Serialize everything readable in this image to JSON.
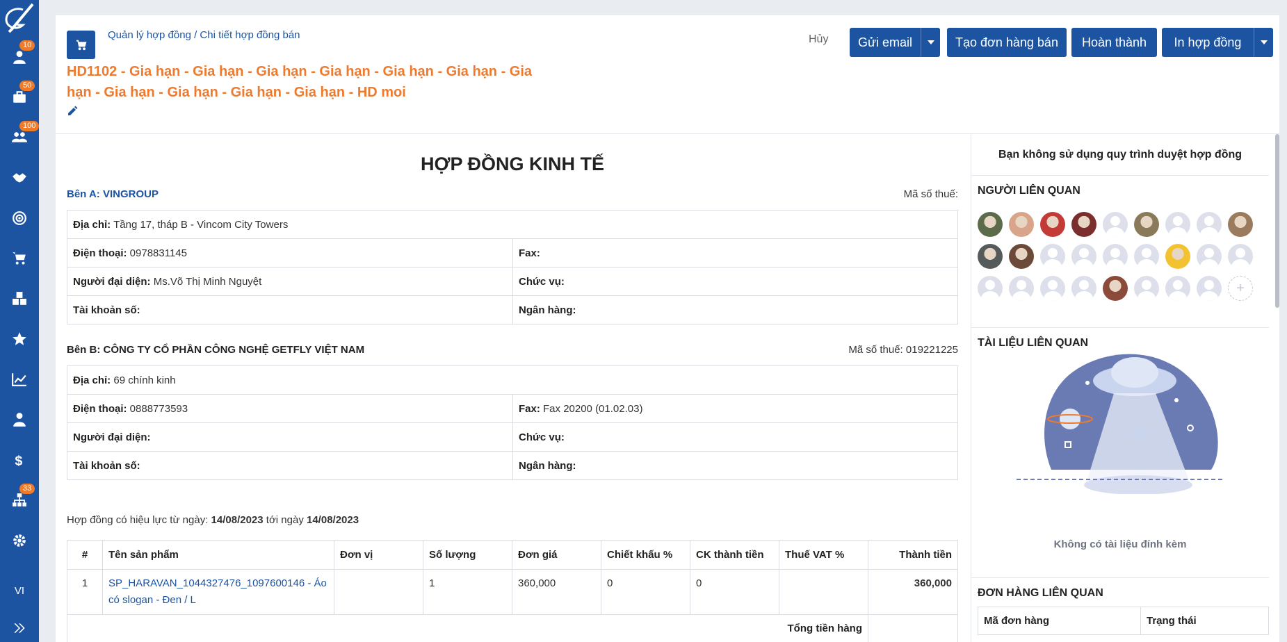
{
  "sidebar": {
    "items": [
      {
        "icon": "user-icon",
        "badge": "10"
      },
      {
        "icon": "briefcase-icon",
        "badge": "50"
      },
      {
        "icon": "users-icon",
        "badge": "100"
      },
      {
        "icon": "handshake-icon",
        "badge": ""
      },
      {
        "icon": "target-icon",
        "badge": ""
      },
      {
        "icon": "cart-icon",
        "badge": ""
      },
      {
        "icon": "cubes-icon",
        "badge": ""
      },
      {
        "icon": "star-icon",
        "badge": ""
      },
      {
        "icon": "chart-line-icon",
        "badge": ""
      },
      {
        "icon": "user-tie-icon",
        "badge": ""
      },
      {
        "icon": "dollar-icon",
        "badge": ""
      },
      {
        "icon": "sitemap-icon",
        "badge": "33"
      },
      {
        "icon": "gear-icon",
        "badge": ""
      }
    ],
    "lang": "VI"
  },
  "header": {
    "breadcrumb": "Quản lý hợp đồng / Chi tiết hợp đồng bán",
    "title": "HD1102 - Gia hạn - Gia hạn - Gia hạn - Gia hạn - Gia hạn - Gia hạn - Gia hạn - Gia hạn - Gia hạn - Gia hạn - Gia hạn - HD moi",
    "cancel_label": "Hủy",
    "send_email_label": "Gửi email",
    "create_order_label": "Tạo đơn hàng bán",
    "complete_label": "Hoàn thành",
    "print_label": "In hợp đồng"
  },
  "contract": {
    "doc_title": "HỢP ĐỒNG KINH TẾ",
    "party_a": {
      "heading": "Bên A: VINGROUP",
      "tax_label": "Mã số thuế:",
      "address_label": "Địa chỉ:",
      "address": "Tầng 17, tháp B - Vincom City Towers",
      "phone_label": "Điện thoại:",
      "phone": "0978831145",
      "fax_label": "Fax:",
      "fax": "",
      "rep_label": "Người đại diện:",
      "rep": "Ms.Võ Thị Minh Nguyệt",
      "position_label": "Chức vụ:",
      "position": "",
      "account_label": "Tài khoản số:",
      "account": "",
      "bank_label": "Ngân hàng:",
      "bank": ""
    },
    "party_b": {
      "heading": "Bên B: CÔNG TY CỔ PHẦN CÔNG NGHỆ GETFLY VIỆT NAM",
      "tax_label": "Mã số thuế:",
      "tax": "019221225",
      "address_label": "Địa chỉ:",
      "address": "69 chính kinh",
      "phone_label": "Điện thoại:",
      "phone": "0888773593",
      "fax_label": "Fax:",
      "fax": "Fax 20200 (01.02.03)",
      "rep_label": "Người đại diện:",
      "rep": "",
      "position_label": "Chức vụ:",
      "position": "",
      "account_label": "Tài khoản số:",
      "account": "",
      "bank_label": "Ngân hàng:",
      "bank": ""
    },
    "effective": {
      "prefix": "Hợp đồng có hiệu lực từ ngày:",
      "from": "14/08/2023",
      "middle": "tới ngày",
      "to": "14/08/2023"
    },
    "products": {
      "headers": [
        "#",
        "Tên sản phẩm",
        "Đơn vị",
        "Số lượng",
        "Đơn giá",
        "Chiết khấu %",
        "CK thành tiền",
        "Thuế VAT %",
        "Thành tiền"
      ],
      "rows": [
        {
          "no": "1",
          "name": "SP_HARAVAN_1044327476_1097600146 - Áo có slogan - Đen / L",
          "unit": "",
          "qty": "1",
          "price": "360,000",
          "discount_pct": "0",
          "discount_amount": "0",
          "vat": "",
          "total": "360,000"
        }
      ],
      "total_label": "Tổng tiền hàng"
    }
  },
  "right_panel": {
    "no_approval": "Bạn không sử dụng quy trình duyệt hợp đồng",
    "related_people_title": "NGƯỜI LIÊN QUAN",
    "related_docs_title": "TÀI LIỆU LIÊN QUAN",
    "no_docs": "Không có tài liệu đính kèm",
    "related_orders_title": "ĐƠN HÀNG LIÊN QUAN",
    "orders_headers": [
      "Mã đơn hàng",
      "Trạng thái"
    ]
  },
  "colors": {
    "primary": "#1c54a2",
    "accent": "#ee7a2e",
    "badge": "#f07a25"
  }
}
